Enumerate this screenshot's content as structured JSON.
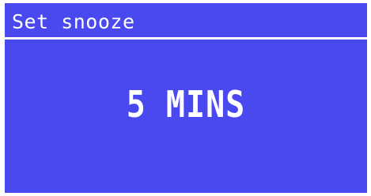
{
  "screen": {
    "title": "Set snooze",
    "value": "5 MINS"
  },
  "colors": {
    "background": "#4a49ef",
    "text": "#ffffff"
  }
}
